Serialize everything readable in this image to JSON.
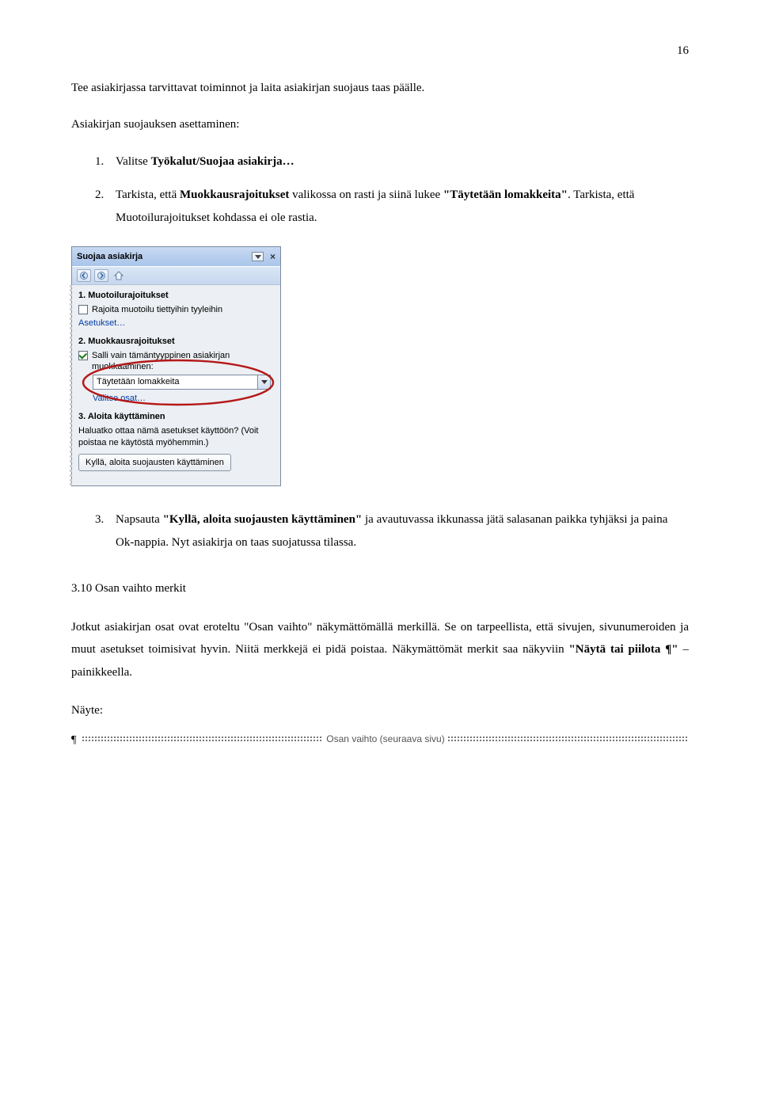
{
  "pageNumber": "16",
  "p1": "Tee asiakirjassa tarvittavat toiminnot ja laita asiakirjan suojaus taas päälle.",
  "p2": "Asiakirjan suojauksen asettaminen:",
  "list1": {
    "n1": "1.",
    "t1a": "Valitse ",
    "t1b": "Työkalut/Suojaa asiakirja…",
    "n2": "2.",
    "t2a": "Tarkista, että ",
    "t2b": "Muokkausrajoitukset",
    "t2c": " valikossa on rasti ja siinä lukee ",
    "t2d": "\"Täytetään lomakkeita\"",
    "t2e": ". Tarkista, että Muotoilurajoitukset kohdassa ei ole rastia."
  },
  "pane": {
    "title": "Suojaa asiakirja",
    "close": "×",
    "s1": "1. Muotoilurajoitukset",
    "s1chk": "Rajoita muotoilu tiettyihin tyyleihin",
    "s1link": "Asetukset…",
    "s2": "2. Muokkausrajoitukset",
    "s2chk": "Salli vain tämäntyyppinen asiakirjan muokkaaminen:",
    "s2combo": "Täytetään lomakkeita",
    "s2link": "Valitse osat…",
    "s3": "3. Aloita käyttäminen",
    "s3txt": "Haluatko ottaa nämä asetukset käyttöön? (Voit poistaa ne käytöstä myöhemmin.)",
    "s3btn": "Kyllä, aloita suojausten käyttäminen"
  },
  "list2": {
    "n3": "3.",
    "t3a": "Napsauta ",
    "t3b": "\"Kyllä, aloita suojausten käyttäminen\"",
    "t3c": " ja avautuvassa ikkunassa jätä salasanan paikka tyhjäksi ja paina Ok-nappia. Nyt asiakirja on taas suojatussa tilassa."
  },
  "h3": "3.10  Osan vaihto merkit",
  "p3a": "Jotkut asiakirjan osat ovat eroteltu \"Osan vaihto\" näkymättömällä merkillä. Se on tarpeellista, että sivujen, sivunumeroiden ja muut asetukset toimisivat hyvin. Niitä merkkejä ei pidä poistaa. Näkymättömät merkit saa näkyviin ",
  "p3b": "\"Näytä tai piilota ¶\"",
  "p3c": " –painikkeella.",
  "sample": "Näyte:",
  "sb": {
    "pilcrow": "¶",
    "label": "Osan vaihto (seuraava sivu)"
  }
}
